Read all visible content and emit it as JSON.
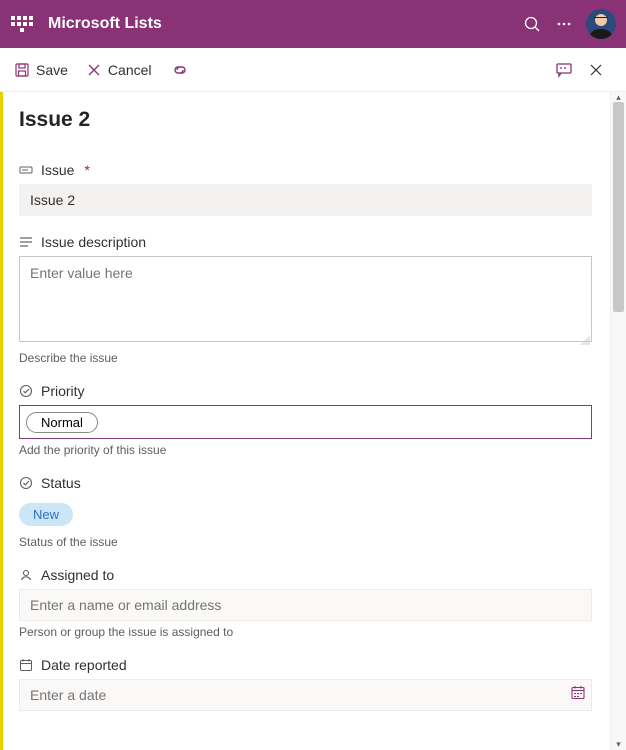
{
  "appbar": {
    "title": "Microsoft Lists"
  },
  "cmdbar": {
    "save": "Save",
    "cancel": "Cancel"
  },
  "form": {
    "title": "Issue 2",
    "issue": {
      "label": "Issue",
      "value": "Issue 2"
    },
    "description": {
      "label": "Issue description",
      "placeholder": "Enter value here",
      "helper": "Describe the issue"
    },
    "priority": {
      "label": "Priority",
      "value": "Normal",
      "helper": "Add the priority of this issue"
    },
    "status": {
      "label": "Status",
      "value": "New",
      "helper": "Status of the issue"
    },
    "assigned": {
      "label": "Assigned to",
      "placeholder": "Enter a name or email address",
      "helper": "Person or group the issue is assigned to"
    },
    "date_reported": {
      "label": "Date reported",
      "placeholder": "Enter a date"
    }
  }
}
